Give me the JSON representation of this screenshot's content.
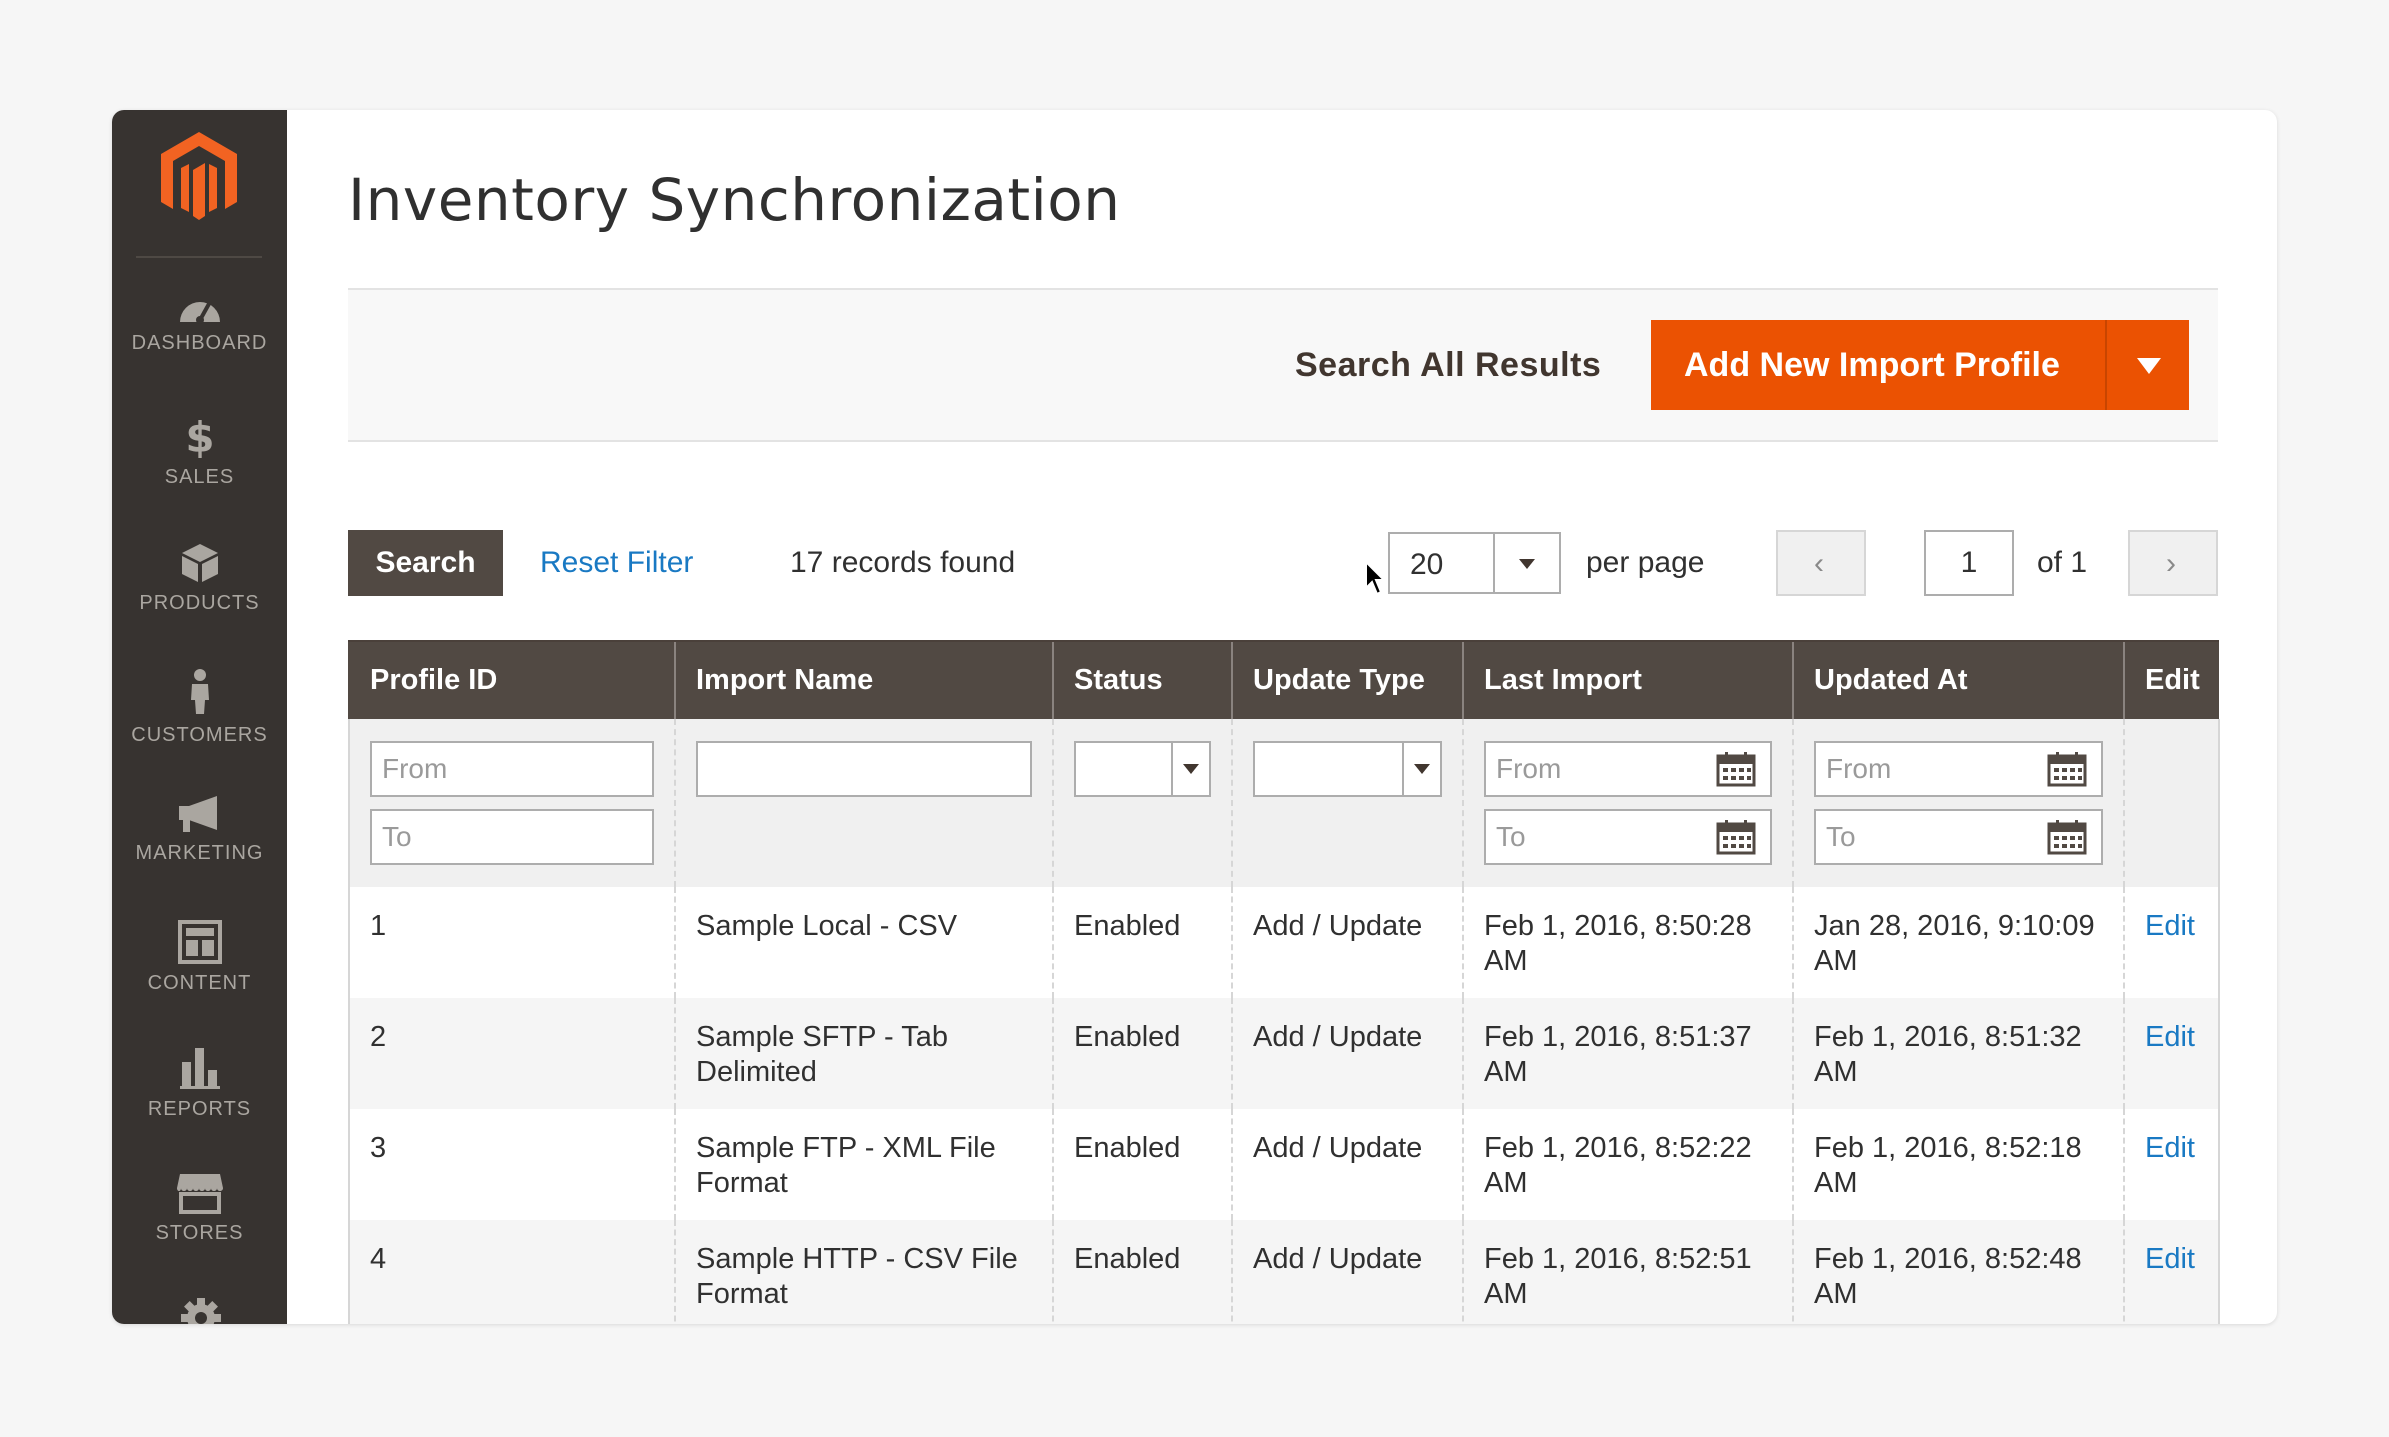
{
  "sidebar": {
    "logo": "magento-logo",
    "items": [
      {
        "label": "DASHBOARD",
        "icon": "dashboard-icon"
      },
      {
        "label": "SALES",
        "icon": "dollar-icon"
      },
      {
        "label": "PRODUCTS",
        "icon": "box-icon"
      },
      {
        "label": "CUSTOMERS",
        "icon": "person-icon"
      },
      {
        "label": "MARKETING",
        "icon": "megaphone-icon"
      },
      {
        "label": "CONTENT",
        "icon": "layout-icon"
      },
      {
        "label": "REPORTS",
        "icon": "bar-chart-icon"
      },
      {
        "label": "STORES",
        "icon": "store-icon"
      }
    ]
  },
  "page": {
    "title": "Inventory Synchronization"
  },
  "actions": {
    "search_all": "Search All Results",
    "add_new": "Add New Import Profile"
  },
  "toolbar": {
    "search_label": "Search",
    "reset_label": "Reset Filter",
    "records": "17 records found",
    "per_page_value": "20",
    "per_page_label": "per page",
    "page_value": "1",
    "of_pages": "of 1"
  },
  "grid": {
    "columns": [
      "Profile ID",
      "Import Name",
      "Status",
      "Update Type",
      "Last Import",
      "Updated At",
      "Edit"
    ],
    "filters": {
      "from": "From",
      "to": "To"
    },
    "rows": [
      {
        "id": "1",
        "name": "Sample Local - CSV",
        "status": "Enabled",
        "update_type": "Add / Update",
        "last_import": "Feb 1, 2016, 8:50:28 AM",
        "updated_at": "Jan 28, 2016, 9:10:09 AM",
        "edit": "Edit"
      },
      {
        "id": "2",
        "name": "Sample SFTP - Tab Delimited",
        "status": "Enabled",
        "update_type": "Add / Update",
        "last_import": "Feb 1, 2016, 8:51:37 AM",
        "updated_at": "Feb 1, 2016, 8:51:32 AM",
        "edit": "Edit"
      },
      {
        "id": "3",
        "name": "Sample FTP - XML File Format",
        "status": "Enabled",
        "update_type": "Add / Update",
        "last_import": "Feb 1, 2016, 8:52:22 AM",
        "updated_at": "Feb 1, 2016, 8:52:18 AM",
        "edit": "Edit"
      },
      {
        "id": "4",
        "name": "Sample HTTP - CSV File Format",
        "status": "Enabled",
        "update_type": "Add / Update",
        "last_import": "Feb 1, 2016, 8:52:51 AM",
        "updated_at": "Feb 1, 2016, 8:52:48 AM",
        "edit": "Edit"
      }
    ]
  },
  "colors": {
    "accent": "#eb5202",
    "sidebar": "#373330",
    "header": "#514943",
    "link": "#1979c3"
  }
}
